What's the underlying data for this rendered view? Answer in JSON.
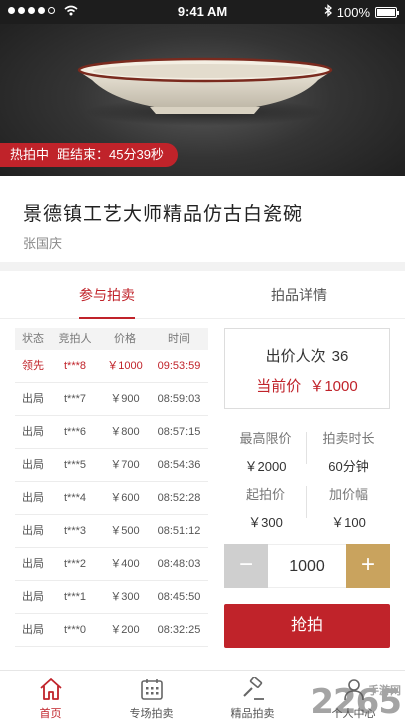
{
  "status_bar": {
    "time": "9:41 AM",
    "battery": "100%"
  },
  "hero": {
    "badge_status": "热拍中",
    "badge_countdown": "距结束：45分39秒"
  },
  "item": {
    "title": "景德镇工艺大师精品仿古白瓷碗",
    "author": "张国庆"
  },
  "tabs": [
    {
      "label": "参与拍卖"
    },
    {
      "label": "拍品详情"
    }
  ],
  "bid_table": {
    "headers": [
      "状态",
      "竞拍人",
      "价格",
      "时间"
    ],
    "rows": [
      {
        "status": "领先",
        "bidder": "t***8",
        "price": "￥1000",
        "time": "09:53:59"
      },
      {
        "status": "出局",
        "bidder": "t***7",
        "price": "￥900",
        "time": "08:59:03"
      },
      {
        "status": "出局",
        "bidder": "t***6",
        "price": "￥800",
        "time": "08:57:15"
      },
      {
        "status": "出局",
        "bidder": "t***5",
        "price": "￥700",
        "time": "08:54:36"
      },
      {
        "status": "出局",
        "bidder": "t***4",
        "price": "￥600",
        "time": "08:52:28"
      },
      {
        "status": "出局",
        "bidder": "t***3",
        "price": "￥500",
        "time": "08:51:12"
      },
      {
        "status": "出局",
        "bidder": "t***2",
        "price": "￥400",
        "time": "08:48:03"
      },
      {
        "status": "出局",
        "bidder": "t***1",
        "price": "￥300",
        "time": "08:45:50"
      },
      {
        "status": "出局",
        "bidder": "t***0",
        "price": "￥200",
        "time": "08:32:25"
      }
    ]
  },
  "summary": {
    "bid_count_label": "出价人次",
    "bid_count": "36",
    "current_price_label": "当前价",
    "current_price": "￥1000"
  },
  "info": {
    "max_price_label": "最高限价",
    "max_price": "￥2000",
    "duration_label": "拍卖时长",
    "duration": "60分钟",
    "start_price_label": "起拍价",
    "start_price": "￥300",
    "increment_label": "加价幅",
    "increment": "￥100"
  },
  "stepper": {
    "minus": "−",
    "value": "1000",
    "plus": "+"
  },
  "bid_button": "抢拍",
  "bottom_nav": [
    {
      "label": "首页",
      "icon": "home-icon"
    },
    {
      "label": "专场拍卖",
      "icon": "calendar-icon"
    },
    {
      "label": "精品拍卖",
      "icon": "gavel-icon"
    },
    {
      "label": "个人中心",
      "icon": "user-icon"
    }
  ],
  "watermark": {
    "text": "2265",
    "sub": "手游网"
  },
  "colors": {
    "accent": "#c0232a",
    "gold": "#c9a35e"
  }
}
